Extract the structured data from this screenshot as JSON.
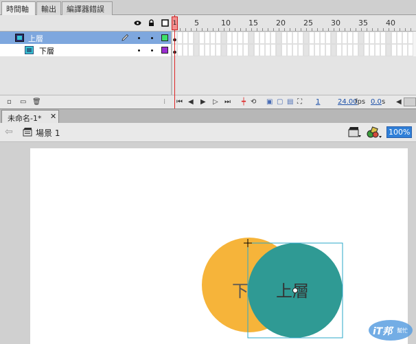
{
  "panel_tabs": [
    "時間軸",
    "輸出",
    "編譯器錯誤"
  ],
  "timeline": {
    "ruler_labels": [
      "1",
      "5",
      "10",
      "15",
      "20",
      "25",
      "30",
      "35",
      "40"
    ],
    "layers": [
      {
        "name": "上層",
        "color": "#3ee06a",
        "selected": true
      },
      {
        "name": "下層",
        "color": "#9b2fd1",
        "selected": false
      }
    ],
    "current_frame": "1",
    "fps": "24.00",
    "fps_unit": "fps",
    "time": "0.0",
    "time_unit": "s"
  },
  "document": {
    "tab_title": "未命名-1*",
    "scene_label": "場景 1",
    "zoom": "100%"
  },
  "stage": {
    "lower_circle_label": "下",
    "upper_circle_label": "上層",
    "lower_circle_color": "#f6b43a",
    "upper_circle_color": "#2f9a94",
    "selection_color": "#29a7c9"
  },
  "watermark": "iT邦幫忙",
  "colors": {
    "selected_layer_bg": "#7ea7de",
    "playhead": "#d22222",
    "zoom_bg": "#2f7fd8"
  }
}
